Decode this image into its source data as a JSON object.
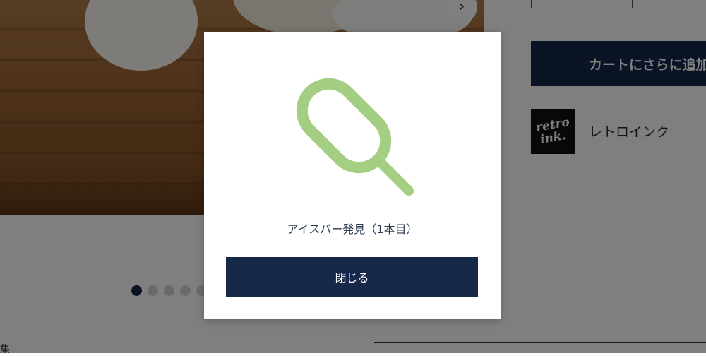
{
  "gallery": {
    "next_icon": "chevron-right-icon",
    "next_glyph": "›",
    "dots_total": 5,
    "active_dot": 1
  },
  "product": {
    "cart_button_label": "カートにさらに追加",
    "brand_logo_text": "retro ink.",
    "brand_name": "レトロインク"
  },
  "page": {
    "corner_text": "集"
  },
  "modal": {
    "icon": "ice-bar-icon",
    "icon_color": "#a4cf82",
    "message": "アイスバー発見（1本目）",
    "close_label": "閉じる"
  },
  "colors": {
    "navy": "#17294a",
    "overlay": "rgba(0,0,0,0.5)"
  }
}
